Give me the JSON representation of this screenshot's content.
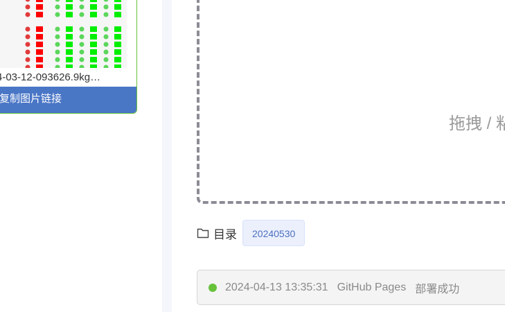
{
  "image_card": {
    "filename": "4-03-12-093626.9kg…",
    "copy_button_label": "复制图片链接"
  },
  "uploader": {
    "hint": "拖拽 / 粘"
  },
  "directory": {
    "label": "目录",
    "tag": "20240530"
  },
  "deploy_status": {
    "time": "2024-04-13 13:35:31",
    "target": "GitHub Pages",
    "result": "部署成功",
    "dot_color": "#67c23a"
  },
  "colors": {
    "accent_blue": "#4a76c6",
    "success_green": "#67c23a",
    "tag_bg": "#ecf0fd",
    "tag_text": "#4c6fbf"
  }
}
